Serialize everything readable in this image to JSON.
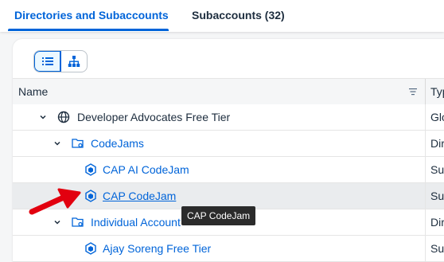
{
  "tabs": [
    {
      "label": "Directories and Subaccounts",
      "active": true
    },
    {
      "label": "Subaccounts (32)",
      "active": false
    }
  ],
  "view_toggle": {
    "options": [
      {
        "icon": "list-icon",
        "selected": true
      },
      {
        "icon": "hierarchy-icon",
        "selected": false
      }
    ]
  },
  "table": {
    "columns": [
      "Name",
      "Typ"
    ],
    "rows": [
      {
        "label": "Developer Advocates Free Tier",
        "icon": "globe-icon",
        "expanded": true,
        "level": 0,
        "type": "Glo",
        "link": false
      },
      {
        "label": "CodeJams",
        "icon": "folder-settings-icon",
        "expanded": true,
        "level": 1,
        "type": "Dir",
        "link": true
      },
      {
        "label": "CAP AI CodeJam",
        "icon": "subaccount-icon",
        "level": 2,
        "type": "Su",
        "link": true
      },
      {
        "label": "CAP CodeJam",
        "icon": "subaccount-icon",
        "level": 2,
        "type": "Su",
        "link": true,
        "hovered": true
      },
      {
        "label": "Individual Account",
        "icon": "folder-settings-icon",
        "expanded": true,
        "level": 1,
        "type": "Dir",
        "link": true
      },
      {
        "label": "Ajay Soreng Free Tier",
        "icon": "subaccount-icon",
        "level": 2,
        "type": "Su",
        "link": true
      }
    ]
  },
  "tooltip": {
    "text": "CAP CodeJam"
  },
  "colors": {
    "accent": "#0064d9",
    "annotation_arrow": "#e2000f"
  }
}
